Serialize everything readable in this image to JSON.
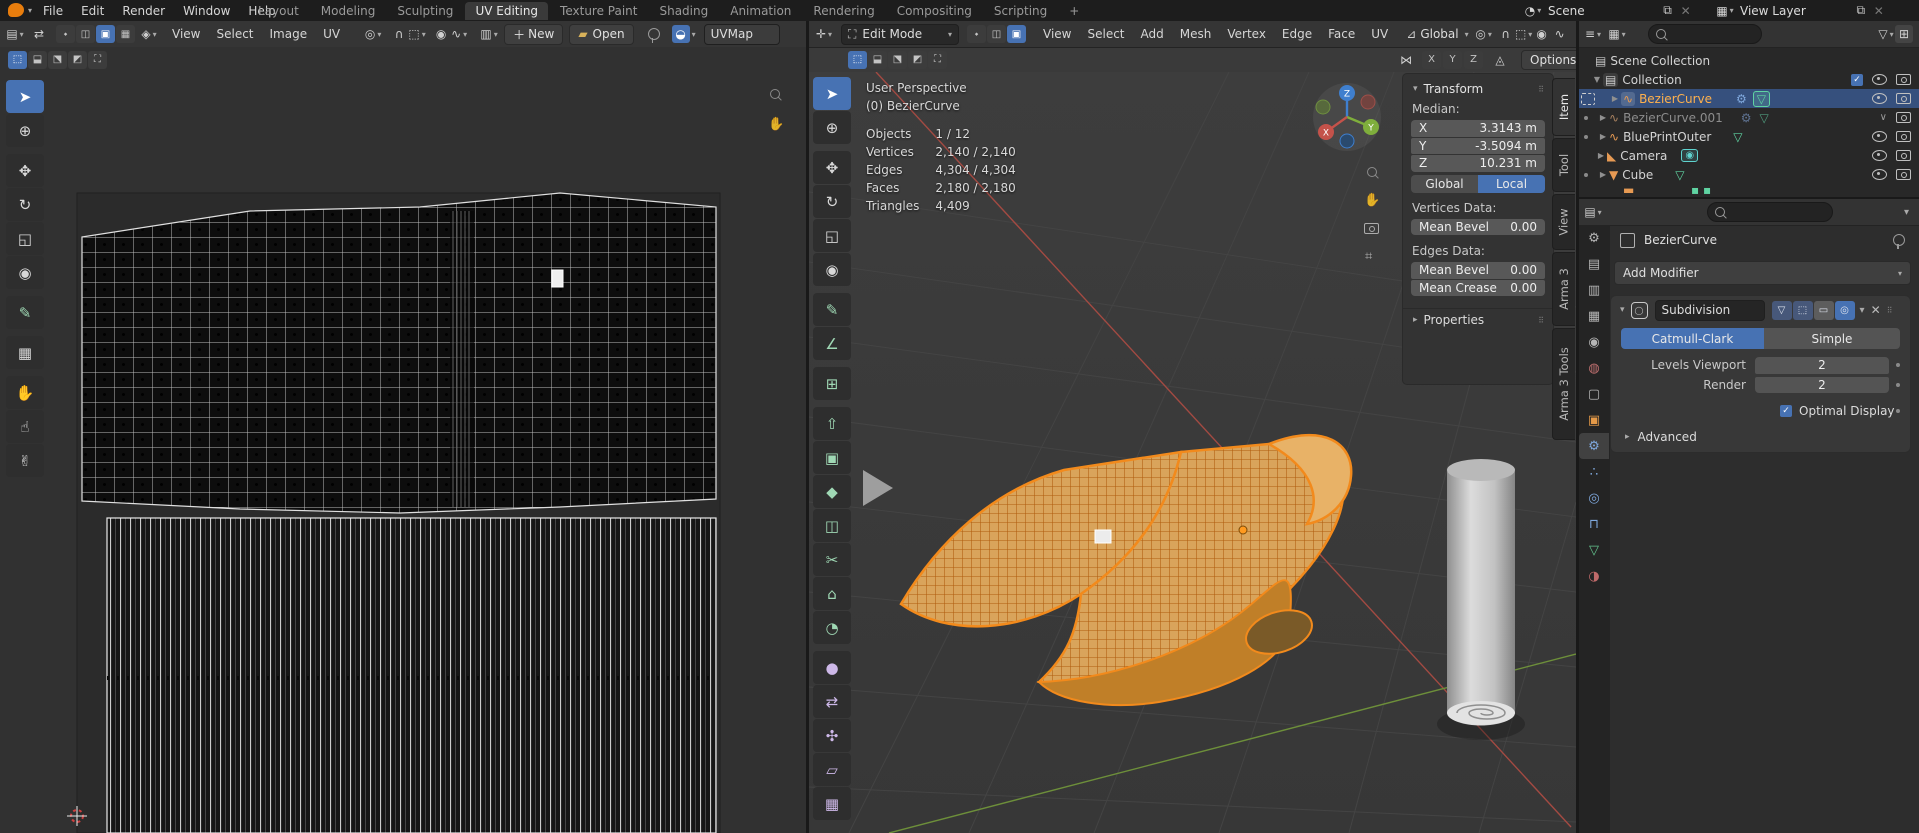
{
  "colors": {
    "accent": "#4772b3",
    "active_object": "#ffb14d",
    "axis_x": "#e0544c",
    "axis_y": "#7fae3c",
    "axis_z": "#3f7fce"
  },
  "topbar": {
    "menus": [
      "File",
      "Edit",
      "Render",
      "Window",
      "Help"
    ],
    "tabs": [
      "Layout",
      "Modeling",
      "Sculpting",
      "UV Editing",
      "Texture Paint",
      "Shading",
      "Animation",
      "Rendering",
      "Compositing",
      "Scripting"
    ],
    "active_tab": "UV Editing",
    "add_tab_label": "+",
    "scene": {
      "label": "Scene"
    },
    "view_layer": {
      "label": "View Layer"
    }
  },
  "uv_editor": {
    "menus": [
      "View",
      "Select",
      "Image",
      "UV"
    ],
    "new_label": "New",
    "open_label": "Open",
    "uvmap_label": "UVMap",
    "tools": [
      {
        "name": "tweak-select",
        "glyph": "➤",
        "active": true
      },
      {
        "name": "cursor",
        "glyph": "⊕"
      },
      {
        "name": "move",
        "glyph": "✥",
        "gap": true
      },
      {
        "name": "rotate",
        "glyph": "↻"
      },
      {
        "name": "scale",
        "glyph": "◱"
      },
      {
        "name": "transform",
        "glyph": "◉"
      },
      {
        "name": "annotate",
        "glyph": "✎",
        "gap": true,
        "color": "#9fd8b4"
      },
      {
        "name": "rip-region",
        "glyph": "▦",
        "gap": true
      },
      {
        "name": "grab",
        "glyph": "✋",
        "gap": true
      },
      {
        "name": "relax",
        "glyph": "☝"
      },
      {
        "name": "pinch",
        "glyph": "✌"
      }
    ]
  },
  "viewport": {
    "mode_label": "Edit Mode",
    "menus": [
      "View",
      "Select",
      "Add",
      "Mesh",
      "Vertex",
      "Edge",
      "Face",
      "UV"
    ],
    "orientation_label": "Global",
    "options_label": "Options",
    "axis_toggles": [
      "X",
      "Y",
      "Z"
    ],
    "overlay": {
      "view": "User Perspective",
      "object": "(0) BezierCurve",
      "rows": [
        {
          "label": "Objects",
          "value": "1 / 12"
        },
        {
          "label": "Vertices",
          "value": "2,140 / 2,140"
        },
        {
          "label": "Edges",
          "value": "4,304 / 4,304"
        },
        {
          "label": "Faces",
          "value": "2,180 / 2,180"
        },
        {
          "label": "Triangles",
          "value": "4,409"
        }
      ]
    },
    "gizmo": {
      "x": "X",
      "y": "Y",
      "z": "Z"
    },
    "tools": [
      {
        "name": "tweak-select",
        "glyph": "➤",
        "active": true
      },
      {
        "name": "cursor",
        "glyph": "⊕"
      },
      {
        "name": "move",
        "glyph": "✥",
        "gap": true
      },
      {
        "name": "rotate",
        "glyph": "↻"
      },
      {
        "name": "scale",
        "glyph": "◱"
      },
      {
        "name": "transform",
        "glyph": "◉"
      },
      {
        "name": "annotate",
        "glyph": "✎",
        "gap": true,
        "color": "#9fd8b4"
      },
      {
        "name": "measure",
        "glyph": "∠",
        "color": "#9fd8b4"
      },
      {
        "name": "add-cube",
        "glyph": "⊞",
        "gap": true,
        "color": "#9fd8b4"
      },
      {
        "name": "extrude-region",
        "glyph": "⇧",
        "gap": true,
        "color": "#9fd8b4"
      },
      {
        "name": "inset-faces",
        "glyph": "▣",
        "color": "#9fd8b4"
      },
      {
        "name": "bevel",
        "glyph": "◆",
        "color": "#9fd8b4"
      },
      {
        "name": "loop-cut",
        "glyph": "◫",
        "color": "#9fd8b4"
      },
      {
        "name": "knife",
        "glyph": "✂",
        "color": "#9fd8b4"
      },
      {
        "name": "poly-build",
        "glyph": "⌂",
        "color": "#9fd8b4"
      },
      {
        "name": "spin",
        "glyph": "◔",
        "color": "#9fd8b4"
      },
      {
        "name": "smooth",
        "glyph": "●",
        "gap": true,
        "color": "#cdb8e8"
      },
      {
        "name": "edge-slide",
        "glyph": "⇄",
        "color": "#cdb8e8"
      },
      {
        "name": "shrink-fatten",
        "glyph": "✣",
        "color": "#cdb8e8"
      },
      {
        "name": "shear",
        "glyph": "▱",
        "color": "#cdb8e8"
      },
      {
        "name": "rip-region",
        "glyph": "▦",
        "color": "#cdb8e8"
      }
    ]
  },
  "npanel": {
    "title": "Transform",
    "median_label": "Median:",
    "axes": [
      {
        "axis": "X",
        "value": "3.3143 m"
      },
      {
        "axis": "Y",
        "value": "-3.5094 m"
      },
      {
        "axis": "Z",
        "value": "10.231 m"
      }
    ],
    "space_buttons": {
      "global": "Global",
      "local": "Local"
    },
    "vertices_data_label": "Vertices Data:",
    "vert_bevel": {
      "label": "Mean Bevel",
      "value": "0.00"
    },
    "edges_data_label": "Edges Data:",
    "edge_bevel": {
      "label": "Mean Bevel",
      "value": "0.00"
    },
    "edge_crease": {
      "label": "Mean Crease",
      "value": "0.00"
    },
    "properties_label": "Properties",
    "tabs": [
      "Item",
      "Tool",
      "View",
      "Arma 3",
      "Arma 3 Tools"
    ]
  },
  "outliner": {
    "rows": {
      "scene_collection": "Scene Collection",
      "collection": "Collection",
      "bezier": "BezierCurve",
      "bezier001": "BezierCurve.001",
      "blueprint": "BluePrintOuter",
      "camera": "Camera",
      "cube": "Cube"
    }
  },
  "properties": {
    "breadcrumb": "BezierCurve",
    "add_modifier_label": "Add Modifier",
    "modifier": {
      "name": "Subdivision",
      "type_active": "Catmull-Clark",
      "type_inactive": "Simple",
      "levels_label": "Levels Viewport",
      "levels_value": "2",
      "render_label": "Render",
      "render_value": "2",
      "optimal_label": "Optimal Display",
      "advanced_label": "Advanced"
    },
    "tabs": [
      {
        "name": "tool",
        "glyph": "⚙",
        "color": "#b5b5b5"
      },
      {
        "name": "render",
        "glyph": "▤",
        "color": "#b5b5b5"
      },
      {
        "name": "output",
        "glyph": "▥",
        "color": "#b5b5b5"
      },
      {
        "name": "view-layer",
        "glyph": "▦",
        "color": "#b5b5b5"
      },
      {
        "name": "scene",
        "glyph": "◉",
        "color": "#b5b5b5"
      },
      {
        "name": "world",
        "glyph": "◍",
        "color": "#c07070"
      },
      {
        "name": "collection",
        "glyph": "▢",
        "color": "#b5b5b5"
      },
      {
        "name": "object",
        "glyph": "▣",
        "color": "#e59a48"
      },
      {
        "name": "modifiers",
        "glyph": "⚙",
        "color": "#7fa8dd",
        "active": true
      },
      {
        "name": "particles",
        "glyph": "∴",
        "color": "#7fa8dd"
      },
      {
        "name": "physics",
        "glyph": "◎",
        "color": "#7fa8dd"
      },
      {
        "name": "constraints",
        "glyph": "⊓",
        "color": "#7fa8dd"
      },
      {
        "name": "object-data",
        "glyph": "▽",
        "color": "#63c28d"
      },
      {
        "name": "material",
        "glyph": "◑",
        "color": "#c06a6a"
      }
    ]
  }
}
